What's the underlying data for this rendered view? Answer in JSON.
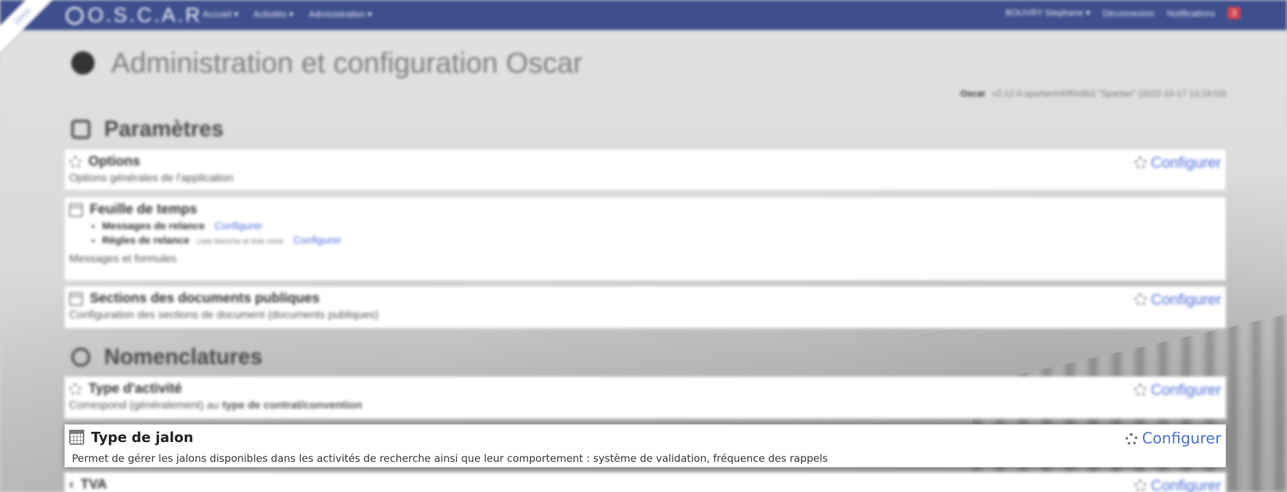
{
  "navbar": {
    "brand": "O.S.C.A.R",
    "ribbon": "Demo",
    "items": [
      "Accueil ▾",
      "Activités ▾",
      "Administration ▾"
    ],
    "user": "BOUVRY Stephane ▾",
    "logout": "Déconnexion",
    "notifications": "Notifications",
    "notif_count": "3"
  },
  "page": {
    "title": "Administration et configuration Oscar",
    "version_name": "Oscar",
    "version_text": "v2.12.0-spartan#d0f0c6b2 \"Spartan\" (2022-10-17 13:19:03)"
  },
  "sections": {
    "parametres": "Paramètres",
    "nomenclatures": "Nomenclatures"
  },
  "cards": {
    "options": {
      "title": "Options",
      "desc": "Options générales de l'application",
      "configure": "Configurer"
    },
    "feuille": {
      "title": "Feuille de temps",
      "sub1_label": "Messages de relance",
      "sub1_link": "Configurer",
      "sub2_label": "Règles de relance",
      "sub2_note": "Liste blanche et liste noire",
      "sub2_link": "Configurer",
      "desc": "Messages et formules"
    },
    "sections_docs": {
      "title": "Sections des documents publiques",
      "desc": "Configuration des sections de document (documents publiques)",
      "configure": "Configurer"
    },
    "type_activite": {
      "title": "Type d'activité",
      "desc_prefix": "Correspond (généralement) au",
      "desc_bold": "type de contrat/convention",
      "configure": "Configurer"
    },
    "type_jalon": {
      "title": "Type de jalon",
      "desc": "Permet de gérer les jalons disponibles dans les activités de recherche ainsi que leur comportement : système de validation, fréquence des rappels",
      "configure": "Configurer"
    },
    "tva": {
      "title": "TVA",
      "configure": "Configurer"
    }
  }
}
